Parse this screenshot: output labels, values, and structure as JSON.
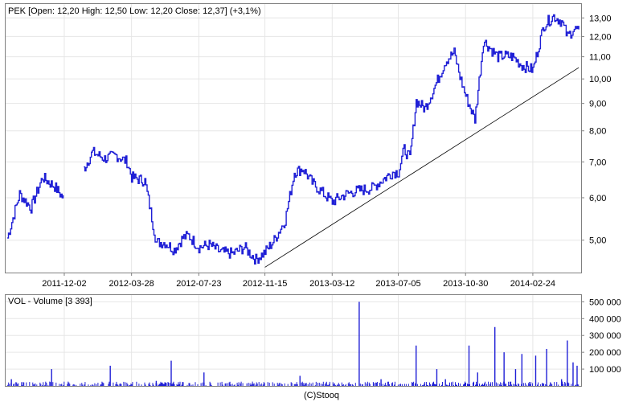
{
  "price_panel": {
    "header": "PEK [Open: 12,20  High: 12,50  Low: 12,20  Close: 12,37] (+3,1%)"
  },
  "volume_panel": {
    "header": "VOL - Volume [3 393]"
  },
  "footer": "(C)Stooq",
  "colors": {
    "price": "#1f1fd6",
    "volume": "#1f1fd6",
    "trendline": "#000000",
    "grid": "#e6e6e6",
    "border": "#808080"
  },
  "chart_data": [
    {
      "type": "line",
      "title": "PEK [Open: 12,20  High: 12,50  Low: 12,20  Close: 12,37] (+3,1%)",
      "xlabel": "",
      "ylabel": "",
      "x_axis": "date",
      "x_ticks": [
        "2011-12-02",
        "2012-03-28",
        "2012-07-23",
        "2012-11-15",
        "2013-03-12",
        "2013-07-05",
        "2013-10-30",
        "2014-02-24"
      ],
      "y_scale": "log",
      "y_ticks": [
        "5,00",
        "6,00",
        "7,00",
        "8,00",
        "9,00",
        "10,00",
        "11,00",
        "12,00",
        "13,00"
      ],
      "ylim": [
        4.35,
        13.8
      ],
      "grid": true,
      "series": [
        {
          "name": "PEK",
          "x": [
            "2011-08-25",
            "2011-09-15",
            "2011-10-05",
            "2011-10-25",
            "2011-11-15",
            "2011-12-02",
            "2011-12-20",
            "2012-01-05",
            "2012-01-20",
            "2012-02-10",
            "2012-03-01",
            "2012-03-20",
            "2012-03-28",
            "2012-04-20",
            "2012-05-10",
            "2012-05-25",
            "2012-06-10",
            "2012-06-25",
            "2012-07-05",
            "2012-07-23",
            "2012-08-10",
            "2012-08-30",
            "2012-09-20",
            "2012-10-10",
            "2012-10-30",
            "2012-11-15",
            "2012-12-01",
            "2012-12-20",
            "2013-01-05",
            "2013-01-20",
            "2013-02-05",
            "2013-02-25",
            "2013-03-12",
            "2013-03-30",
            "2013-04-15",
            "2013-05-01",
            "2013-05-20",
            "2013-06-05",
            "2013-06-25",
            "2013-07-05",
            "2013-07-15",
            "2013-07-25",
            "2013-08-05",
            "2013-08-20",
            "2013-09-05",
            "2013-09-25",
            "2013-10-10",
            "2013-10-20",
            "2013-10-30",
            "2013-11-15",
            "2013-11-30",
            "2013-12-15",
            "2013-12-25",
            "2014-01-05",
            "2014-01-20",
            "2014-02-05",
            "2014-02-24",
            "2014-03-15",
            "2014-04-01",
            "2014-04-15",
            "2014-04-25",
            "2014-05-05",
            "2014-05-15"
          ],
          "values": [
            5.05,
            6.1,
            5.75,
            6.55,
            6.3,
            5.95,
            null,
            6.8,
            7.3,
            7.1,
            7.2,
            7.0,
            6.55,
            6.45,
            4.95,
            4.95,
            4.8,
            5.05,
            5.1,
            4.85,
            4.9,
            4.75,
            4.72,
            4.85,
            4.6,
            4.75,
            5.0,
            5.45,
            6.7,
            6.8,
            6.4,
            6.1,
            5.9,
            6.05,
            6.15,
            6.2,
            6.25,
            6.45,
            6.7,
            6.7,
            7.4,
            7.1,
            9.1,
            8.8,
            9.6,
            10.8,
            11.2,
            10.1,
            9.3,
            8.4,
            11.8,
            11.3,
            11.0,
            11.05,
            11.0,
            10.6,
            10.4,
            12.6,
            13.1,
            12.8,
            12.0,
            12.37,
            12.37
          ]
        },
        {
          "name": "trend",
          "x": [
            "2012-11-15",
            "2014-05-15"
          ],
          "values": [
            4.45,
            10.5
          ]
        }
      ]
    },
    {
      "type": "bar",
      "title": "VOL - Volume [3 393]",
      "xlabel": "",
      "ylabel": "",
      "x_axis": "date",
      "y_ticks": [
        "100 000",
        "200 000",
        "300 000",
        "400 000",
        "500 000"
      ],
      "ylim": [
        0,
        540000
      ],
      "grid": true,
      "series": [
        {
          "name": "VOL",
          "x": [
            "2011-09-01",
            "2011-11-10",
            "2012-02-20",
            "2012-05-10",
            "2012-06-05",
            "2012-08-01",
            "2013-01-15",
            "2013-04-28",
            "2013-06-05",
            "2013-08-05",
            "2013-09-10",
            "2013-09-25",
            "2013-11-05",
            "2013-11-20",
            "2013-12-20",
            "2014-01-05",
            "2014-01-25",
            "2014-02-05",
            "2014-03-01",
            "2014-03-20",
            "2014-04-15",
            "2014-04-25",
            "2014-05-05",
            "2014-05-12"
          ],
          "values": [
            40000,
            100000,
            120000,
            30000,
            150000,
            80000,
            60000,
            500000,
            40000,
            240000,
            100000,
            40000,
            240000,
            80000,
            350000,
            200000,
            100000,
            190000,
            180000,
            220000,
            40000,
            270000,
            140000,
            120000
          ]
        }
      ]
    }
  ]
}
